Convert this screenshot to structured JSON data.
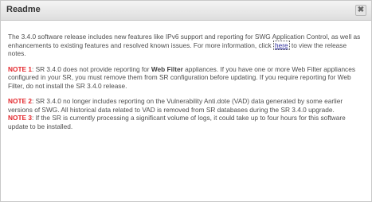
{
  "dialog": {
    "title": "Readme",
    "close_glyph": "✖"
  },
  "intro": {
    "text_before_link": "The 3.4.0 software release includes new features like IPv6 support and reporting for SWG Application Control, as well as enhancements to existing features and resolved known issues. For more information, click ",
    "link_text": "here",
    "text_after_link": " to view the release notes."
  },
  "note1": {
    "label": "NOTE 1",
    "text_before_bold": ": SR 3.4.0 does not provide reporting for ",
    "bold_text": "Web Filter",
    "text_after_bold": " appliances. If you have one or more Web Filter appliances configured in your SR, you must remove them from SR configuration before updating. If you require reporting for Web Filter, do not install the SR 3.4.0 release."
  },
  "note2": {
    "label": "NOTE 2",
    "text": ": SR 3.4.0 no longer includes reporting on the Vulnerability Anti.dote (VAD) data generated by some earlier versions of SWG. All historical data related to VAD is removed from SR databases during the SR 3.4.0 upgrade."
  },
  "note3": {
    "label": "NOTE 3",
    "text": ": If the SR is currently processing a significant volume of logs, it could take up to four hours for this software update to be installed."
  }
}
